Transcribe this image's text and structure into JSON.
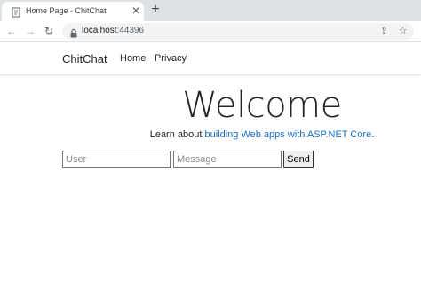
{
  "browser": {
    "tab": {
      "title": "Home Page - ChitChat",
      "close_glyph": "✕",
      "favicon": "page-icon"
    },
    "new_tab_glyph": "+",
    "back_glyph": "←",
    "forward_glyph": "→",
    "reload_glyph": "↻",
    "address": {
      "host": "localhost",
      "port": ":44396"
    },
    "share_glyph": "⇪",
    "bookmark_glyph": "☆"
  },
  "navbar": {
    "brand": "ChitChat",
    "links": [
      {
        "label": "Home"
      },
      {
        "label": "Privacy"
      }
    ]
  },
  "main": {
    "heading": "Welcome",
    "learn_prefix": "Learn about ",
    "learn_link": "building Web apps with ASP.NET Core",
    "learn_suffix": ".",
    "user_placeholder": "User",
    "message_placeholder": "Message",
    "send_label": "Send"
  },
  "colors": {
    "link": "#1b6ec2",
    "tabstrip": "#dee1e6"
  }
}
